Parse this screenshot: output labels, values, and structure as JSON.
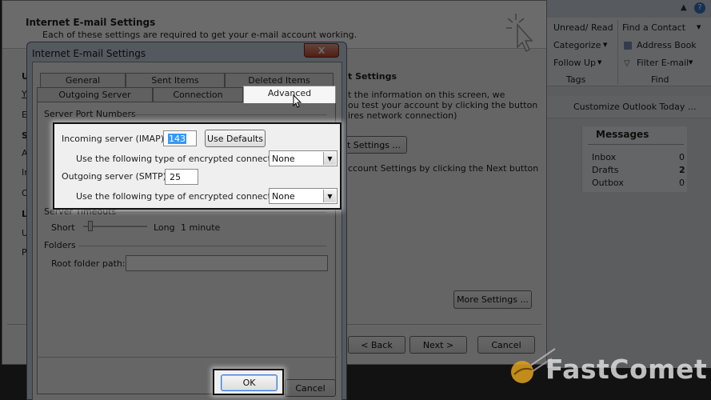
{
  "outer_wizard": {
    "title": "Internet E-mail Settings",
    "subtitle": "Each of these settings are required to get your e-mail account working.",
    "test_heading": "t Settings",
    "test_text_1": "t the information on this screen, we",
    "test_text_2": "ou test your account by clicking the button",
    "test_text_3": "ires network connection)",
    "test_button": "t Settings ...",
    "next_note": "ccount Settings by clicking the Next button",
    "more_settings_button": "More Settings ...",
    "back_button": "< Back",
    "next_button": "Next >",
    "cancel_button": "Cancel",
    "left_letters": [
      "U",
      "Y",
      "E",
      "S",
      "A",
      "In",
      "O",
      "L",
      "U",
      "P"
    ]
  },
  "ribbon": {
    "unread_read": "Unread/ Read",
    "categorize": "Categorize",
    "follow_up": "Follow Up",
    "tags_group": "Tags",
    "find_contact": "Find a Contact",
    "address_book": "Address Book",
    "filter_email": "Filter E-mail",
    "find_group": "Find",
    "help_icon": "?"
  },
  "outlook_today": {
    "customize": "Customize Outlook Today ...",
    "messages_header": "Messages",
    "rows": [
      {
        "name": "Inbox",
        "count": "0"
      },
      {
        "name": "Drafts",
        "count": "2"
      },
      {
        "name": "Outbox",
        "count": "0"
      }
    ]
  },
  "dialog": {
    "title": "Internet E-mail Settings",
    "close_icon": "X",
    "tabs": {
      "general": "General",
      "sent_items": "Sent Items",
      "deleted_items": "Deleted Items",
      "outgoing_server": "Outgoing Server",
      "connection": "Connection",
      "advanced": "Advanced"
    },
    "server_port_numbers": "Server Port Numbers",
    "incoming_label": "Incoming server (IMAP):",
    "incoming_value": "143",
    "use_defaults": "Use Defaults",
    "encrypt_label": "Use the following type of encrypted connection:",
    "incoming_encryption": "None",
    "outgoing_label": "Outgoing server (SMTP):",
    "outgoing_value": "25",
    "outgoing_encryption": "None",
    "server_timeouts": "Server Timeouts",
    "short": "Short",
    "long": "Long",
    "timeout_value": "1 minute",
    "timeout_fraction": 0.08,
    "folders": "Folders",
    "root_folder_label": "Root folder path:",
    "root_folder_value": "",
    "ok_button": "OK",
    "cancel_button": "Cancel"
  },
  "watermark": {
    "brand": "FastComet"
  }
}
